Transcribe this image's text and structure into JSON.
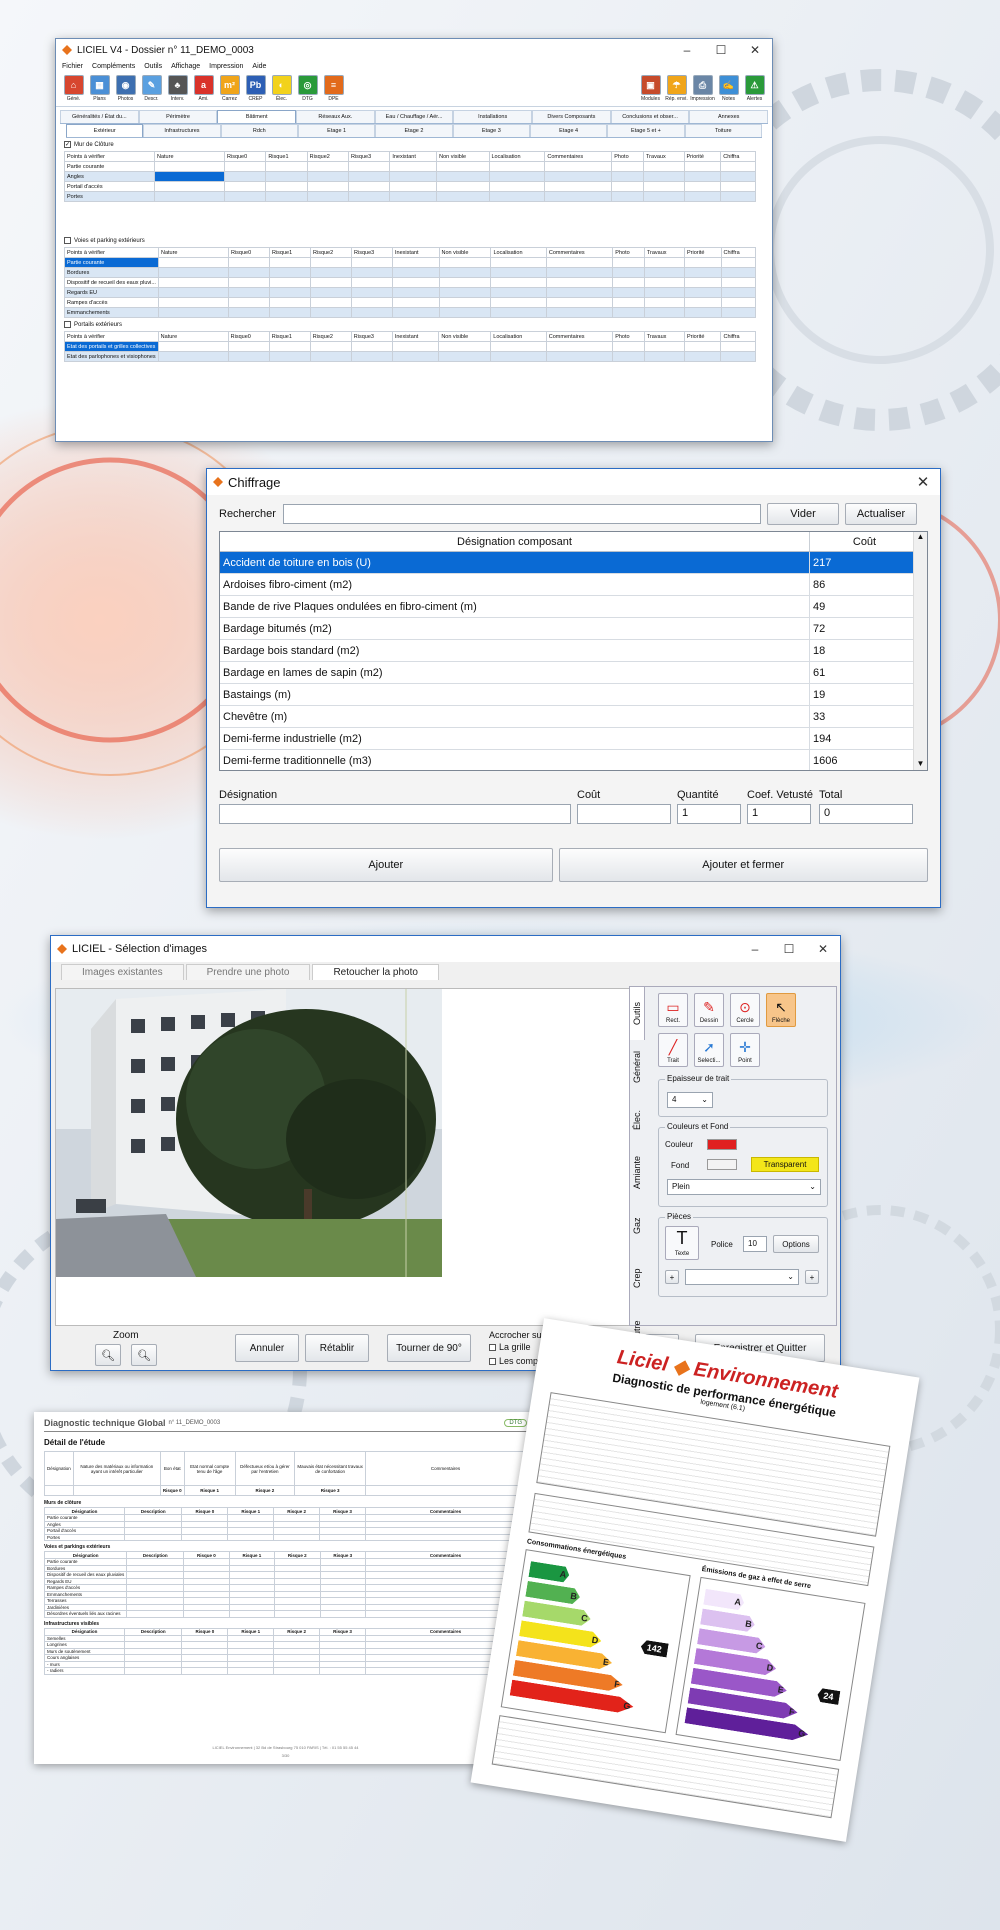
{
  "w1": {
    "title": "LICIEL V4 - Dossier n° 11_DEMO_0003",
    "menu": [
      "Fichier",
      "Compléments",
      "Outils",
      "Affichage",
      "Impression",
      "Aide"
    ],
    "toolbar_left": [
      {
        "label": "Géné.",
        "color": "#d7462f",
        "glyph": "⌂"
      },
      {
        "label": "Plans",
        "color": "#4a8fd6",
        "glyph": "▦"
      },
      {
        "label": "Photos",
        "color": "#3d6fb0",
        "glyph": "◉"
      },
      {
        "label": "Descr.",
        "color": "#5aa0e0",
        "glyph": "✎"
      },
      {
        "label": "Interv.",
        "color": "#555555",
        "glyph": "♣"
      },
      {
        "label": "Ami.",
        "color": "#d9322a",
        "glyph": "a"
      },
      {
        "label": "Carrez",
        "color": "#f0a51a",
        "glyph": "m²"
      },
      {
        "label": "CREP",
        "color": "#2d5fb5",
        "glyph": "Pb"
      },
      {
        "label": "Élec.",
        "color": "#f2d21c",
        "glyph": "◐"
      },
      {
        "label": "DTG",
        "color": "#2a9a3a",
        "glyph": "◎"
      },
      {
        "label": "DPE",
        "color": "#e26a1b",
        "glyph": "≡"
      }
    ],
    "toolbar_right": [
      {
        "label": "Modules",
        "color": "#c64b2b",
        "glyph": "▣"
      },
      {
        "label": "Rép. envi.",
        "color": "#f0a51a",
        "glyph": "☂"
      },
      {
        "label": "Impression",
        "color": "#6a86a6",
        "glyph": "⎙"
      },
      {
        "label": "Notes",
        "color": "#3d8fd6",
        "glyph": "✍"
      },
      {
        "label": "Alertes",
        "color": "#2a9a3a",
        "glyph": "⚠"
      }
    ],
    "tabs": [
      "Généralités / État du...",
      "Périmètre",
      "Bâtiment",
      "Réseaux Aux.",
      "Eau / Chauffage / Aér...",
      "Installations",
      "Divers Composants",
      "Conclusions et obser...",
      "Annexes"
    ],
    "subtabs": [
      "Extérieur",
      "Infrastructures",
      "Rdch",
      "Etage 1",
      "Etage 2",
      "Etage 3",
      "Etage 4",
      "Etage 5 et +",
      "Toiture"
    ],
    "section1": "Mur de Clôture",
    "section2": "Voies et parking extérieurs",
    "section3": "Portails extérieurs",
    "cols1": [
      "Points à vérifier",
      "Nature",
      "Risque0",
      "Risque1",
      "Risque2",
      "Risque3",
      "Inexistant",
      "Non visible",
      "Localisation",
      "Commentaires",
      "Photo",
      "Travaux",
      "Priorité",
      "Chiffra"
    ],
    "rows1": [
      "Partie courante",
      "Angles",
      "Portail d'accès",
      "Portes"
    ],
    "rows2": [
      "Partie courante",
      "Bordures",
      "Dispositif de recueil des eaux pluvi...",
      "Regards EU",
      "Rampes d'accès",
      "Emmanchements"
    ],
    "rows3": [
      "Etat des portails et grilles collectives",
      "Etat des parlophones et visiophones"
    ]
  },
  "w2": {
    "title": "Chiffrage",
    "search_label": "Rechercher",
    "vider": "Vider",
    "actualiser": "Actualiser",
    "col_designation": "Désignation composant",
    "col_cout": "Coût",
    "rows": [
      {
        "name": "Accident de toiture en bois (U)",
        "cost": "217"
      },
      {
        "name": "Ardoises fibro-ciment (m2)",
        "cost": "86"
      },
      {
        "name": "Bande de rive Plaques ondulées en fibro-ciment (m)",
        "cost": "49"
      },
      {
        "name": "Bardage bitumés (m2)",
        "cost": "72"
      },
      {
        "name": "Bardage bois standard (m2)",
        "cost": "18"
      },
      {
        "name": "Bardage en lames de sapin (m2)",
        "cost": "61"
      },
      {
        "name": "Bastaings (m)",
        "cost": "19"
      },
      {
        "name": "Chevêtre (m)",
        "cost": "33"
      },
      {
        "name": "Demi-ferme industrielle (m2)",
        "cost": "194"
      },
      {
        "name": "Demi-ferme traditionnelle (m3)",
        "cost": "1606"
      }
    ],
    "f_designation": "Désignation",
    "f_cout": "Coût",
    "f_quantite": "Quantité",
    "f_coef": "Coef. Vetusté",
    "f_total": "Total",
    "v_quantite": "1",
    "v_coef": "1",
    "v_total": "0",
    "ajouter": "Ajouter",
    "ajouter_fermer": "Ajouter et fermer"
  },
  "w3": {
    "title": "LICIEL - Sélection d'images",
    "tabs": [
      "Images existantes",
      "Prendre une photo",
      "Retoucher la photo"
    ],
    "vtabs": [
      "Outils",
      "Général",
      "Élec.",
      "Amiante",
      "Gaz",
      "Crep",
      "Autre",
      "NF-46-023"
    ],
    "tools": [
      "Rect.",
      "Dessin",
      "Cercle",
      "Flèche",
      "Trait",
      "Selecti...",
      "Point"
    ],
    "epaisseur": "Epaisseur de trait",
    "epaisseur_val": "4",
    "couleurs": "Couleurs et Fond",
    "couleur": "Couleur",
    "fond": "Fond",
    "transparent": "Transparent",
    "plein": "Plein",
    "pieces": "Pièces",
    "texte": "Texte",
    "police": "Police",
    "police_val": "10",
    "options": "Options",
    "zoom": "Zoom",
    "annuler": "Annuler",
    "retablir": "Rétablir",
    "tourner": "Tourner de 90°",
    "accrocher": "Accrocher sur:",
    "grille": "La grille",
    "composants": "Les composants",
    "enregistrer": "Enregistrer et Quitter"
  },
  "doc1": {
    "title": "Diagnostic technique Global",
    "num": "n° 11_DEMO_0003",
    "badge": "DTG",
    "heading": "Détail de l'étude",
    "cols": [
      "Désignation",
      "Nature des matériaux ou information ayant un intérêt particulier",
      "Bon état",
      "Etat normal compte tenu de l'âge",
      "Défectueux et/ou à gérer par l'entretien",
      "Mauvais état nécessitant travaux de confortation",
      "Commentaires"
    ],
    "risk": [
      "Risque 0",
      "Risque 1",
      "Risque 2",
      "Risque 3"
    ],
    "sub": [
      "Désignation",
      "Description",
      "Risque 0",
      "Risque 1",
      "Risque 2",
      "Risque 3",
      "Commentaires"
    ],
    "g1": "Murs de clôture",
    "g1rows": [
      "Partie courante",
      "Angles",
      "Portail d'accès",
      "Portes"
    ],
    "g2": "Voies et parkings extérieurs",
    "g2rows": [
      "Partie courante",
      "Bordures",
      "Dispositif de recueil des eaux pluviales",
      "Regards EU",
      "Rampes d'accès",
      "Emmanchements",
      "Terrasses",
      "Jardinières",
      "Désordres éventuels liés aux racines"
    ],
    "g3": "Infrastructures visibles",
    "g3rows": [
      "Semelles",
      "Longrines",
      "Murs de soutènement",
      "Cours anglaises",
      "- murs",
      "- radiers"
    ],
    "footer": "LICIEL Environnement | 32 Bd de Strasbourg 75 010 PARIS | Tél. : 01 55 55 45 44",
    "page": "3/30"
  },
  "doc2": {
    "brand": "Liciel",
    "brand2": "Environnement",
    "title": "Diagnostic de performance énergétique",
    "subtitle": "logement (6.1)",
    "box1": "Consommations énergétiques",
    "box2": "Émissions de gaz à effet de serre",
    "conso": "142",
    "ges": "24",
    "classes": [
      "A",
      "B",
      "C",
      "D",
      "E",
      "F",
      "G"
    ]
  }
}
